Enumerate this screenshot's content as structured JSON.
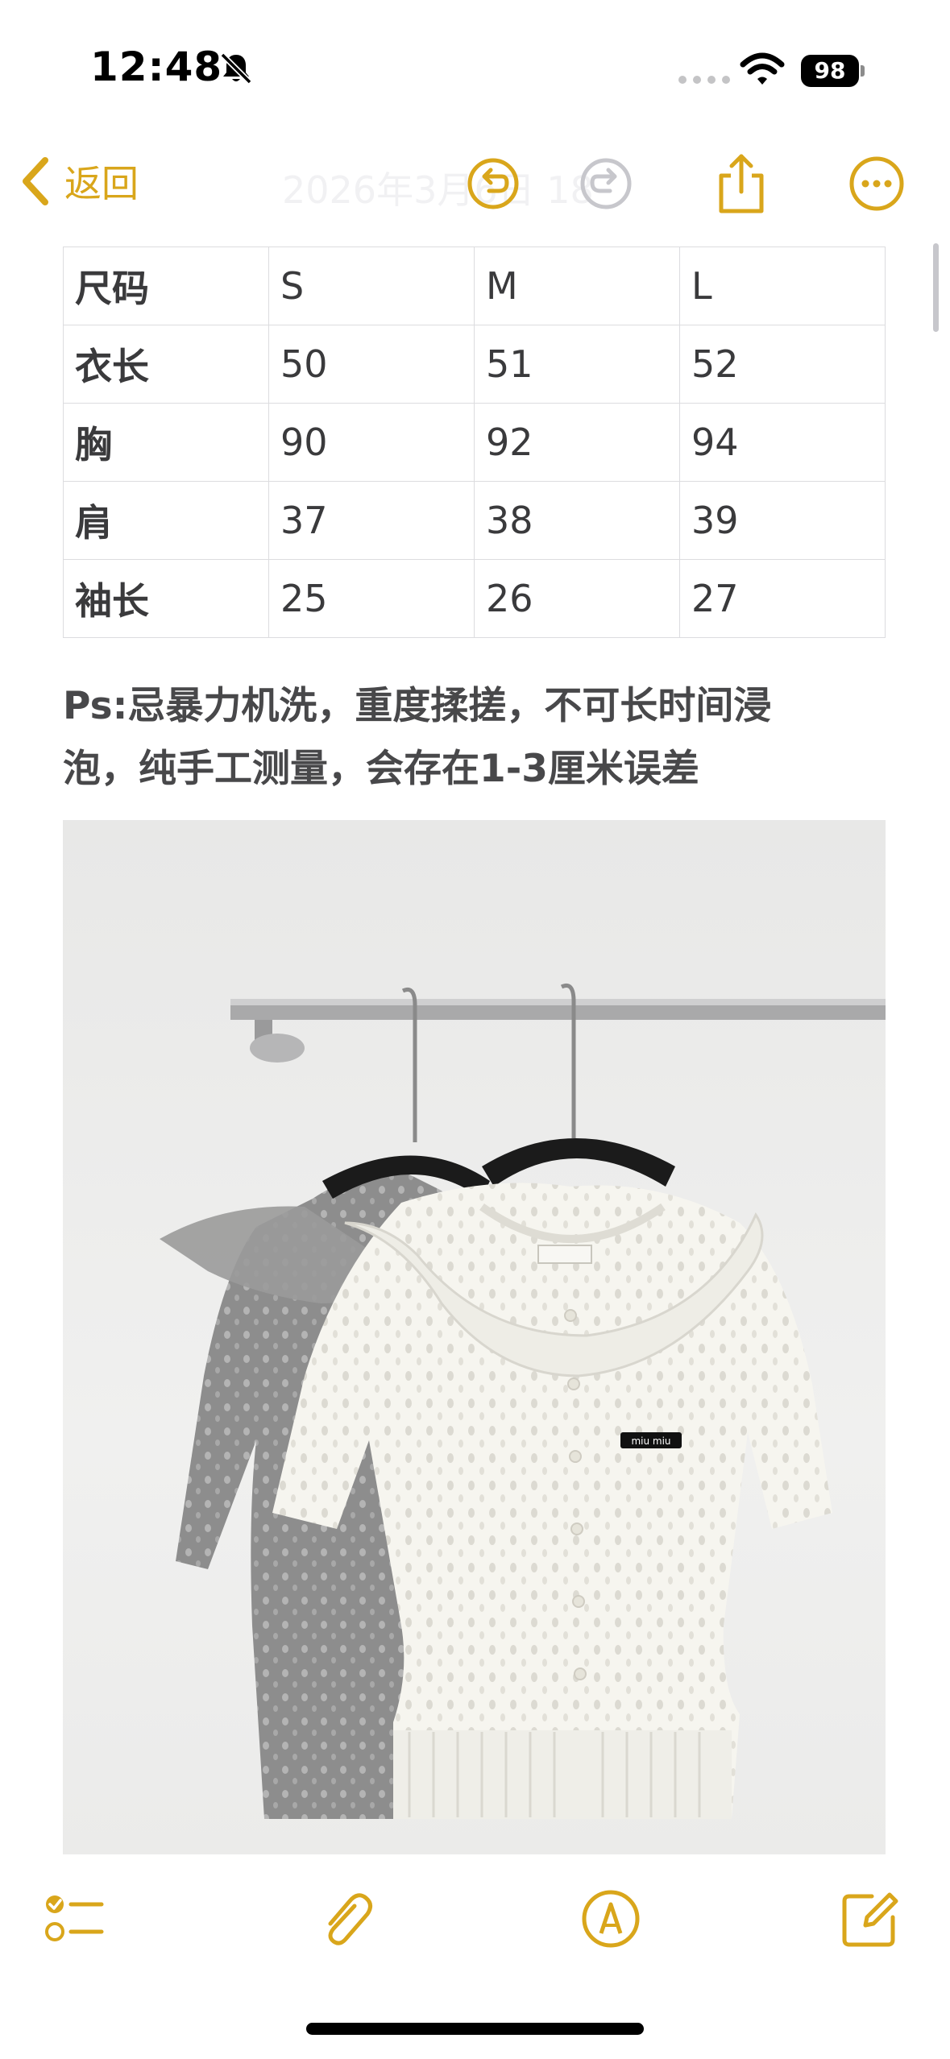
{
  "status": {
    "time": "12:48",
    "battery": "98",
    "icons": [
      "bell-slash-icon",
      "signal-dots-icon",
      "wifi-icon",
      "battery-icon"
    ]
  },
  "nav": {
    "back_label": "返回",
    "title": "2026年3月6日 18",
    "icons": [
      "chevron-left-icon",
      "undo-icon",
      "redo-icon",
      "share-icon",
      "more-icon"
    ]
  },
  "size_table": {
    "rows": [
      [
        "尺码",
        "S",
        "M",
        "L"
      ],
      [
        "衣长",
        "50",
        "51",
        "52"
      ],
      [
        "胸",
        "90",
        "92",
        "94"
      ],
      [
        "肩",
        "37",
        "38",
        "39"
      ],
      [
        "袖长",
        "25",
        "26",
        "27"
      ]
    ]
  },
  "note": {
    "line1": "Ps:忌暴力机洗，重度揉搓，不可长时间浸",
    "line2": "泡，纯手工测量，会存在1-3厘米误差"
  },
  "photo": {
    "label_text": "miu miu"
  },
  "toolbar": {
    "icons": [
      "checklist-icon",
      "paperclip-icon",
      "markup-icon",
      "compose-icon"
    ]
  },
  "colors": {
    "accent": "#d9a61b",
    "text": "#3a3a3c",
    "grid": "#dcdcdf"
  }
}
